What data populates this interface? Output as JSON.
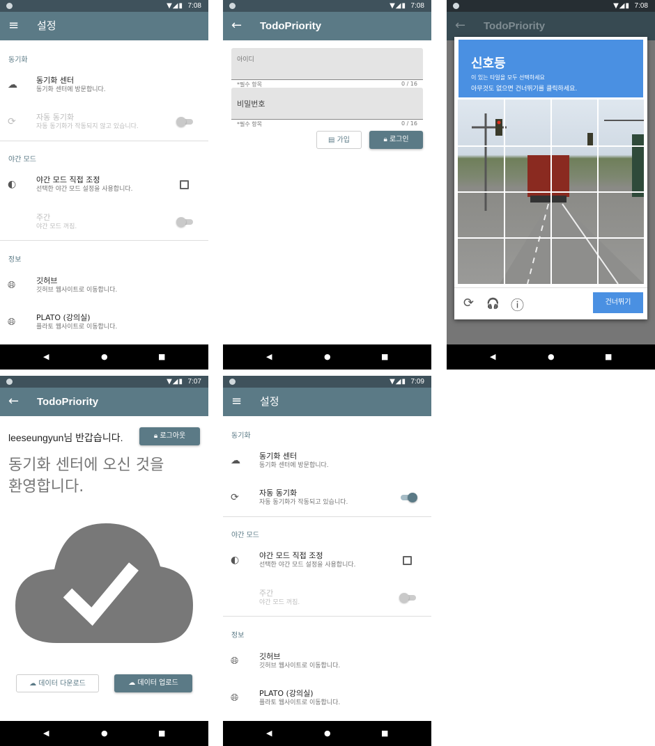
{
  "status_icons": "▼◢▮",
  "nav_icons": {
    "back": "◀",
    "home": "●",
    "recent": "■"
  },
  "colors": {
    "primary": "#5b7a86",
    "statusbar": "#3f525c",
    "captcha_blue": "#4a90e2"
  },
  "settings_1": {
    "time": "7:08",
    "title": "설정",
    "menu_icon": "≡",
    "cat_sync": "동기화",
    "sync_center_title": "동기화 센터",
    "sync_center_sub": "동기화 센터에 방문합니다.",
    "auto_sync_title": "자동 동기화",
    "auto_sync_sub": "자동 동기화가 작동되지 않고 있습니다.",
    "auto_sync_on": false,
    "cat_night": "야간 모드",
    "night_title": "야간 모드 직접 조정",
    "night_sub": "선택한 야간 모드 설정을 사용합니다.",
    "day_title": "주간",
    "day_sub": "야간 모드 꺼짐.",
    "cat_info": "정보",
    "github_title": "깃허브",
    "github_sub": "깃허브 웹사이트로 이동합니다.",
    "plato_title": "PLATO (강의실)",
    "plato_sub": "플라토 웹사이트로 이동합니다."
  },
  "login": {
    "time": "7:08",
    "title": "TodoPriority",
    "back_icon": "←",
    "id_label": "아이디",
    "id_helper": "*필수 항목",
    "id_counter": "0 / 16",
    "pw_placeholder": "비밀번호",
    "pw_helper": "*필수 항목",
    "pw_counter": "0 / 16",
    "signup_label": "가입",
    "login_label": "로그인"
  },
  "captcha": {
    "time": "7:08",
    "bg_title": "TodoPriority",
    "target": "신호등",
    "instruction": "이 있는 타일을 모두 선택하세요",
    "instruction2": "아무것도 없으면 건너뛰기를 클릭하세요.",
    "skip_label": "건너뛰기",
    "reload_icon": "⟳",
    "audio_icon": "🎧",
    "info_icon": "ⓘ"
  },
  "sync": {
    "time": "7:07",
    "title": "TodoPriority",
    "user": "leeseungyun",
    "greeting_suffix": "님 반갑습니다.",
    "logout_label": "로그아웃",
    "welcome_line1": "동기화 센터에 오신 것을",
    "welcome_line2": "환영합니다.",
    "download_label": "데이터 다운로드",
    "upload_label": "데이터 업로드"
  },
  "settings_2": {
    "time": "7:09",
    "title": "설정",
    "cat_sync": "동기화",
    "sync_center_title": "동기화 센터",
    "sync_center_sub": "동기화 센터에 방문합니다.",
    "auto_sync_title": "자동 동기화",
    "auto_sync_sub": "자동 동기화가 작동되고 있습니다.",
    "auto_sync_on": true,
    "cat_night": "야간 모드",
    "night_title": "야간 모드 직접 조정",
    "night_sub": "선택한 야간 모드 설정을 사용합니다.",
    "day_title": "주간",
    "day_sub": "야간 모드 꺼짐.",
    "cat_info": "정보",
    "github_title": "깃허브",
    "github_sub": "깃허브 웹사이트로 이동합니다.",
    "plato_title": "PLATO (강의실)",
    "plato_sub": "플라토 웹사이트로 이동합니다."
  }
}
